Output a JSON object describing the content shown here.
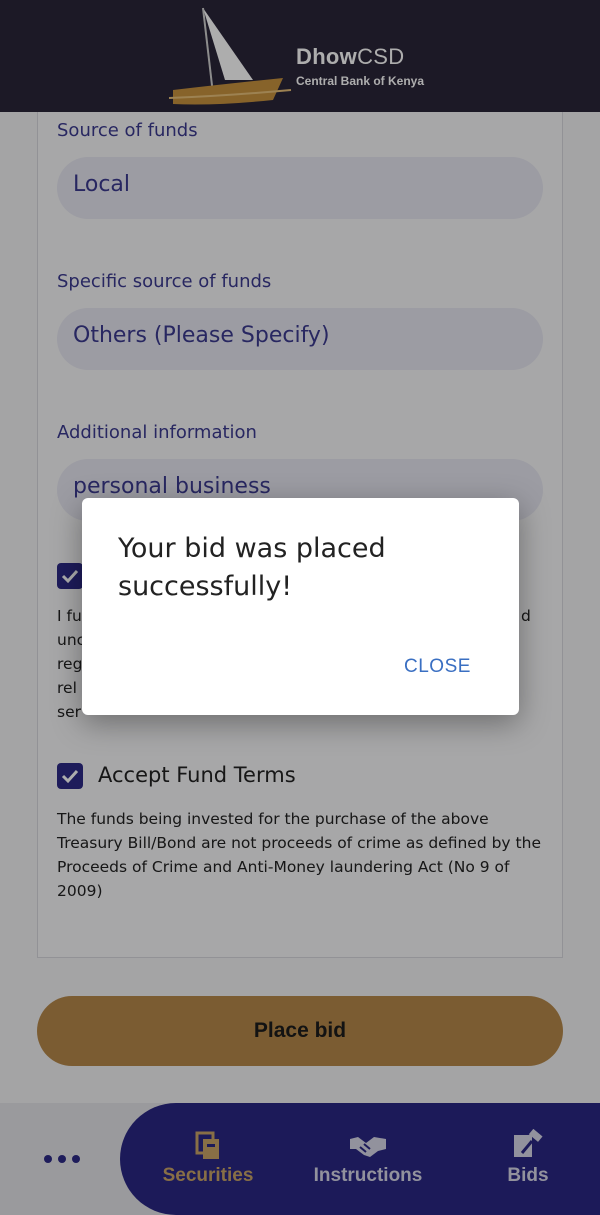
{
  "header": {
    "brand_bold": "Dhow",
    "brand_light": "CSD",
    "subtitle": "Central Bank of Kenya",
    "logo_icon": "dhow-sailboat-icon"
  },
  "form": {
    "source_of_funds": {
      "label": "Source of funds",
      "value": "Local"
    },
    "specific_source": {
      "label": "Specific source of funds",
      "value": "Others (Please Specify)"
    },
    "additional_info": {
      "label": "Additional information",
      "value": "personal business"
    },
    "declaration": {
      "checked": true,
      "text_lines": [
        "I fu",
        "unc",
        "reg",
        "rel",
        "ser"
      ],
      "text_right": "d"
    },
    "fund_terms": {
      "checked": true,
      "title": "Accept Fund Terms",
      "text": "The funds being invested for the purchase of the above Treasury Bill/Bond are not proceeds of crime as defined by the Proceeds of Crime and Anti-Money laundering Act (No 9 of 2009)"
    },
    "place_bid_label": "Place bid"
  },
  "bottom_nav": {
    "more_icon": "more-dots-icon",
    "items": [
      {
        "label": "Securities",
        "icon": "securities-icon",
        "active": true
      },
      {
        "label": "Instructions",
        "icon": "handshake-icon",
        "active": false
      },
      {
        "label": "Bids",
        "icon": "gavel-icon",
        "active": false
      }
    ]
  },
  "dialog": {
    "message": "Your bid was placed successfully!",
    "close_label": "CLOSE"
  },
  "colors": {
    "header_bg": "#2a2538",
    "primary": "#2d2a86",
    "accent": "#b5884a",
    "active_nav": "#c9a467",
    "link": "#3a6fc2"
  }
}
